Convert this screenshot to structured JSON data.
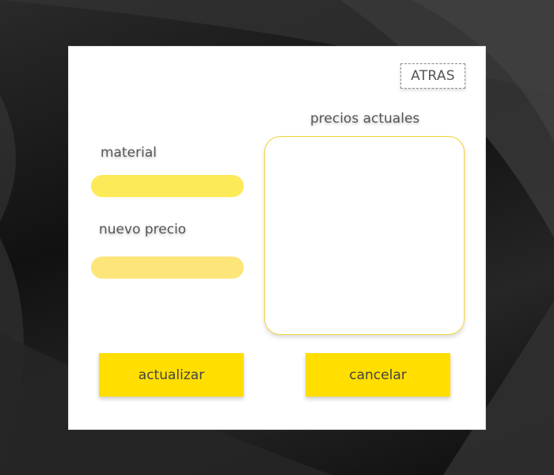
{
  "header": {
    "back_label": "ATRAS"
  },
  "form": {
    "material_label": "material",
    "material_value": "",
    "price_label": "nuevo precio",
    "price_value": ""
  },
  "current_prices": {
    "title": "precios actuales",
    "items": []
  },
  "actions": {
    "update_label": "actualizar",
    "cancel_label": "cancelar"
  },
  "colors": {
    "accent": "#ffde00",
    "input_material": "#fdea58",
    "input_price": "#fde57a",
    "list_border": "#f3d53a"
  }
}
